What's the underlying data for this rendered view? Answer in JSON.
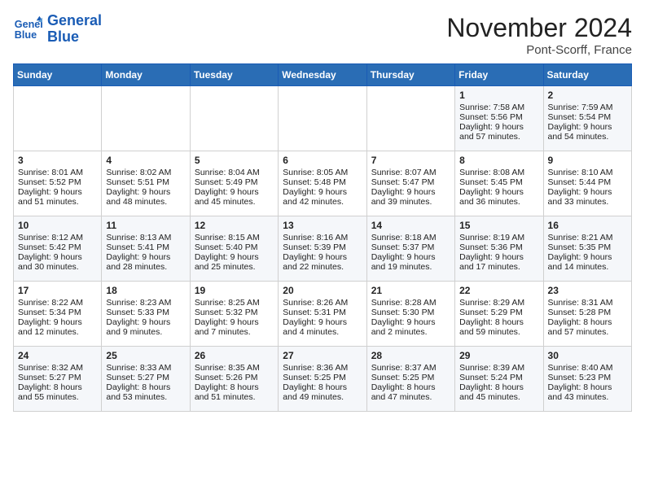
{
  "header": {
    "logo_line1": "General",
    "logo_line2": "Blue",
    "month": "November 2024",
    "location": "Pont-Scorff, France"
  },
  "weekdays": [
    "Sunday",
    "Monday",
    "Tuesday",
    "Wednesday",
    "Thursday",
    "Friday",
    "Saturday"
  ],
  "weeks": [
    [
      {
        "day": "",
        "info": ""
      },
      {
        "day": "",
        "info": ""
      },
      {
        "day": "",
        "info": ""
      },
      {
        "day": "",
        "info": ""
      },
      {
        "day": "",
        "info": ""
      },
      {
        "day": "1",
        "info": "Sunrise: 7:58 AM\nSunset: 5:56 PM\nDaylight: 9 hours and 57 minutes."
      },
      {
        "day": "2",
        "info": "Sunrise: 7:59 AM\nSunset: 5:54 PM\nDaylight: 9 hours and 54 minutes."
      }
    ],
    [
      {
        "day": "3",
        "info": "Sunrise: 8:01 AM\nSunset: 5:52 PM\nDaylight: 9 hours and 51 minutes."
      },
      {
        "day": "4",
        "info": "Sunrise: 8:02 AM\nSunset: 5:51 PM\nDaylight: 9 hours and 48 minutes."
      },
      {
        "day": "5",
        "info": "Sunrise: 8:04 AM\nSunset: 5:49 PM\nDaylight: 9 hours and 45 minutes."
      },
      {
        "day": "6",
        "info": "Sunrise: 8:05 AM\nSunset: 5:48 PM\nDaylight: 9 hours and 42 minutes."
      },
      {
        "day": "7",
        "info": "Sunrise: 8:07 AM\nSunset: 5:47 PM\nDaylight: 9 hours and 39 minutes."
      },
      {
        "day": "8",
        "info": "Sunrise: 8:08 AM\nSunset: 5:45 PM\nDaylight: 9 hours and 36 minutes."
      },
      {
        "day": "9",
        "info": "Sunrise: 8:10 AM\nSunset: 5:44 PM\nDaylight: 9 hours and 33 minutes."
      }
    ],
    [
      {
        "day": "10",
        "info": "Sunrise: 8:12 AM\nSunset: 5:42 PM\nDaylight: 9 hours and 30 minutes."
      },
      {
        "day": "11",
        "info": "Sunrise: 8:13 AM\nSunset: 5:41 PM\nDaylight: 9 hours and 28 minutes."
      },
      {
        "day": "12",
        "info": "Sunrise: 8:15 AM\nSunset: 5:40 PM\nDaylight: 9 hours and 25 minutes."
      },
      {
        "day": "13",
        "info": "Sunrise: 8:16 AM\nSunset: 5:39 PM\nDaylight: 9 hours and 22 minutes."
      },
      {
        "day": "14",
        "info": "Sunrise: 8:18 AM\nSunset: 5:37 PM\nDaylight: 9 hours and 19 minutes."
      },
      {
        "day": "15",
        "info": "Sunrise: 8:19 AM\nSunset: 5:36 PM\nDaylight: 9 hours and 17 minutes."
      },
      {
        "day": "16",
        "info": "Sunrise: 8:21 AM\nSunset: 5:35 PM\nDaylight: 9 hours and 14 minutes."
      }
    ],
    [
      {
        "day": "17",
        "info": "Sunrise: 8:22 AM\nSunset: 5:34 PM\nDaylight: 9 hours and 12 minutes."
      },
      {
        "day": "18",
        "info": "Sunrise: 8:23 AM\nSunset: 5:33 PM\nDaylight: 9 hours and 9 minutes."
      },
      {
        "day": "19",
        "info": "Sunrise: 8:25 AM\nSunset: 5:32 PM\nDaylight: 9 hours and 7 minutes."
      },
      {
        "day": "20",
        "info": "Sunrise: 8:26 AM\nSunset: 5:31 PM\nDaylight: 9 hours and 4 minutes."
      },
      {
        "day": "21",
        "info": "Sunrise: 8:28 AM\nSunset: 5:30 PM\nDaylight: 9 hours and 2 minutes."
      },
      {
        "day": "22",
        "info": "Sunrise: 8:29 AM\nSunset: 5:29 PM\nDaylight: 8 hours and 59 minutes."
      },
      {
        "day": "23",
        "info": "Sunrise: 8:31 AM\nSunset: 5:28 PM\nDaylight: 8 hours and 57 minutes."
      }
    ],
    [
      {
        "day": "24",
        "info": "Sunrise: 8:32 AM\nSunset: 5:27 PM\nDaylight: 8 hours and 55 minutes."
      },
      {
        "day": "25",
        "info": "Sunrise: 8:33 AM\nSunset: 5:27 PM\nDaylight: 8 hours and 53 minutes."
      },
      {
        "day": "26",
        "info": "Sunrise: 8:35 AM\nSunset: 5:26 PM\nDaylight: 8 hours and 51 minutes."
      },
      {
        "day": "27",
        "info": "Sunrise: 8:36 AM\nSunset: 5:25 PM\nDaylight: 8 hours and 49 minutes."
      },
      {
        "day": "28",
        "info": "Sunrise: 8:37 AM\nSunset: 5:25 PM\nDaylight: 8 hours and 47 minutes."
      },
      {
        "day": "29",
        "info": "Sunrise: 8:39 AM\nSunset: 5:24 PM\nDaylight: 8 hours and 45 minutes."
      },
      {
        "day": "30",
        "info": "Sunrise: 8:40 AM\nSunset: 5:23 PM\nDaylight: 8 hours and 43 minutes."
      }
    ]
  ]
}
